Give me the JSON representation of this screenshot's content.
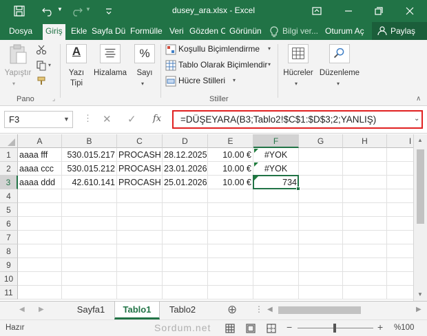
{
  "window": {
    "title": "dusey_ara.xlsx - Excel"
  },
  "tabs": [
    "Dosya",
    "Giriş",
    "Ekle",
    "Sayfa Dü",
    "Formülle",
    "Veri",
    "Gözden C",
    "Görünün"
  ],
  "tell_me": "Bilgi ver...",
  "account": {
    "signin": "Oturum Aç",
    "share": "Paylaş"
  },
  "ribbon": {
    "paste": "Yapıştır",
    "clipboard_group": "Pano",
    "font": "Yazı Tipi",
    "alignment": "Hizalama",
    "number": "Sayı",
    "conditional": "Koşullu Biçimlendirme",
    "as_table": "Tablo Olarak Biçimlendir",
    "cell_styles": "Hücre Stilleri",
    "styles_group": "Stiller",
    "cells": "Hücreler",
    "editing": "Düzenleme"
  },
  "formula_bar": {
    "name_box": "F3",
    "fx": "fx",
    "formula": "=DÜŞEYARA(B3;Tablo2!$C$1:$D$3;2;YANLIŞ)"
  },
  "columns": [
    "A",
    "B",
    "C",
    "D",
    "E",
    "F",
    "G",
    "H",
    "I"
  ],
  "rows": [
    "1",
    "2",
    "3",
    "4",
    "5",
    "6",
    "7",
    "8",
    "9",
    "10",
    "11"
  ],
  "cells": [
    [
      "aaaa fff",
      "530.015.217",
      "PROCASH",
      "28.12.2025",
      "10.00 €",
      "#YOK"
    ],
    [
      "aaaa ccc",
      "530.015.212",
      "PROCASH",
      "23.01.2026",
      "10.00 €",
      "#YOK"
    ],
    [
      "aaaa ddd",
      "42.610.141",
      "PROCASH",
      "25.01.2026",
      "10.00 €",
      "734"
    ]
  ],
  "sheets": [
    "Sayfa1",
    "Tablo1",
    "Tablo2"
  ],
  "active_sheet": "Tablo1",
  "status": {
    "ready": "Hazır",
    "watermark": "Sordum.net",
    "zoom": "%100"
  },
  "colors": {
    "excel_green": "#217346",
    "formula_highlight": "#e02020"
  }
}
